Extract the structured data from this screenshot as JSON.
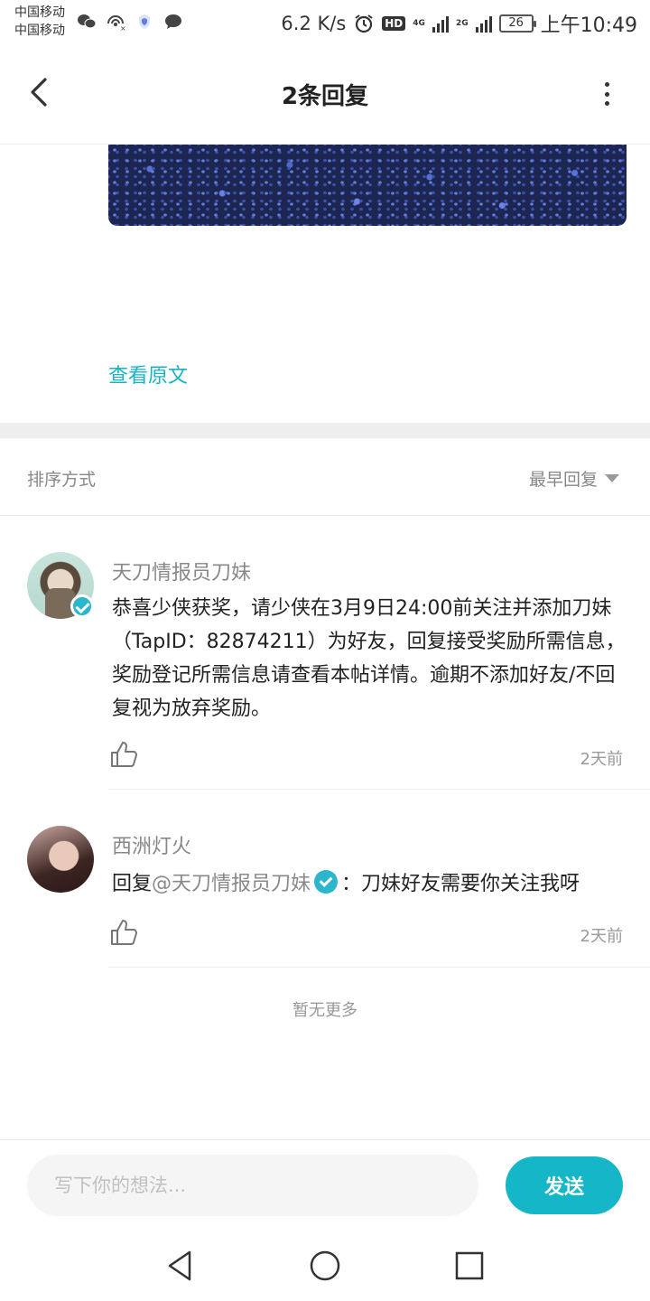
{
  "status_bar": {
    "carrier_1": "中国移动",
    "carrier_2": "中国移动",
    "speed": "6.2 K/s",
    "hd": "HD",
    "net_1": "4G",
    "net_2": "2G",
    "battery": "26",
    "time": "上午10:49"
  },
  "header": {
    "title": "2条回复",
    "back_icon": "chevron-left-icon",
    "more_icon": "more-vertical-icon"
  },
  "post": {
    "view_original": "查看原文"
  },
  "sort": {
    "label": "排序方式",
    "value": "最早回复"
  },
  "comments": [
    {
      "name": "天刀情报员刀妹",
      "text": "恭喜少侠获奖，请少侠在3月9日24:00前关注并添加刀妹（TapID：82874211）为好友，回复接受奖励所需信息，奖励登记所需信息请查看本帖详情。逾期不添加好友/不回复视为放弃奖励。",
      "time": "2天前",
      "verified": true
    },
    {
      "name": "西洲灯火",
      "reply_prefix": "回复",
      "mention": "@天刀情报员刀妹",
      "text": "：刀妹好友需要你关注我呀",
      "time": "2天前"
    }
  ],
  "footer": {
    "no_more": "暂无更多"
  },
  "input_bar": {
    "placeholder": "写下你的想法...",
    "send": "发送"
  },
  "colors": {
    "accent": "#15b6c7",
    "verified": "#2bb6cc"
  }
}
